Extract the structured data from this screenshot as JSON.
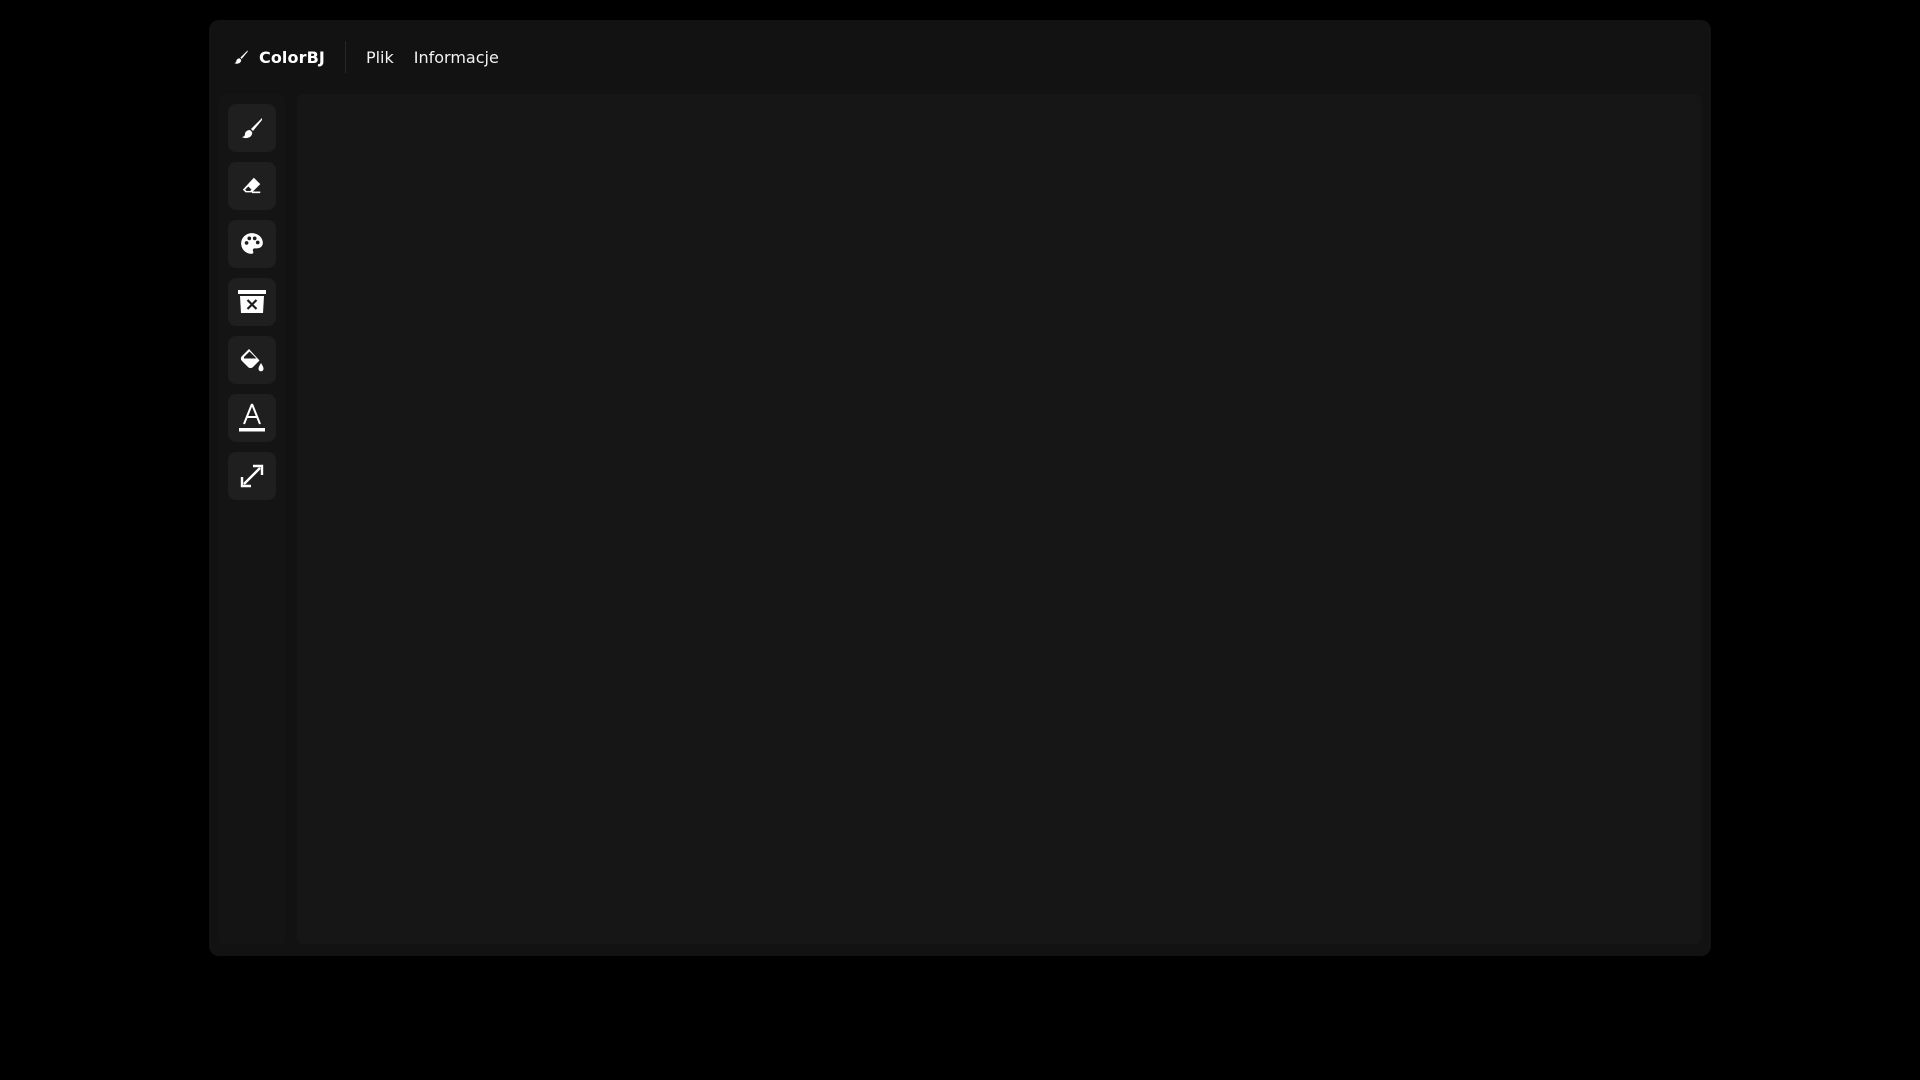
{
  "app": {
    "brand": "ColorBJ",
    "brand_icon": "brush-icon"
  },
  "menu": {
    "items": [
      {
        "label": "Plik"
      },
      {
        "label": "Informacje"
      }
    ]
  },
  "tools": [
    {
      "icon": "brush-icon"
    },
    {
      "icon": "eraser-icon"
    },
    {
      "icon": "palette-icon"
    },
    {
      "icon": "clear-canvas-icon"
    },
    {
      "icon": "fill-bucket-icon"
    },
    {
      "icon": "text-icon"
    },
    {
      "icon": "resize-icon"
    }
  ],
  "colors": {
    "background": "#000000",
    "app": "#121212",
    "tool_button": "#1f1f1f",
    "canvas": "#161616",
    "text": "#ffffff"
  }
}
